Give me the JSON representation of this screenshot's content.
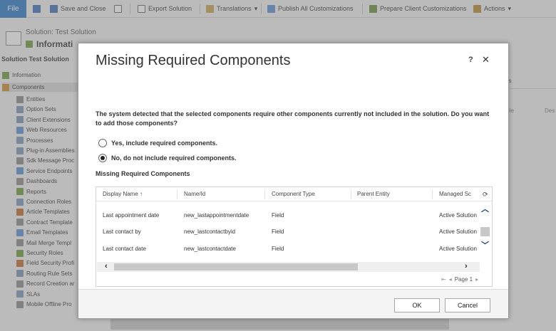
{
  "toolbar": {
    "file": "File",
    "save_and_close": "Save and Close",
    "export_solution": "Export Solution",
    "translations": "Translations",
    "publish_all": "Publish All Customizations",
    "prepare_client": "Prepare Client Customizations",
    "actions": "Actions"
  },
  "background": {
    "solution_title": "Solution: Test Solution",
    "info_title": "Informati",
    "sidebar_heading": "Solution Test Solution",
    "right_tab_partial": "nents",
    "right_col1_partial": "izable",
    "right_col2_partial": "Des",
    "sidebar": [
      {
        "label": "Information",
        "icon": "information-icon"
      },
      {
        "label": "Components",
        "icon": "components-icon"
      },
      {
        "label": "Entities",
        "icon": "entities-icon"
      },
      {
        "label": "Option Sets",
        "icon": "option-sets-icon"
      },
      {
        "label": "Client Extensions",
        "icon": "client-extensions-icon"
      },
      {
        "label": "Web Resources",
        "icon": "web-resources-icon"
      },
      {
        "label": "Processes",
        "icon": "processes-icon"
      },
      {
        "label": "Plug-in Assemblies",
        "icon": "plugin-icon"
      },
      {
        "label": "Sdk Message Proc",
        "icon": "sdk-icon"
      },
      {
        "label": "Service Endpoints",
        "icon": "endpoint-icon"
      },
      {
        "label": "Dashboards",
        "icon": "dashboard-icon"
      },
      {
        "label": "Reports",
        "icon": "reports-icon"
      },
      {
        "label": "Connection Roles",
        "icon": "connection-icon"
      },
      {
        "label": "Article Templates",
        "icon": "article-icon"
      },
      {
        "label": "Contract Template",
        "icon": "contract-icon"
      },
      {
        "label": "Email Templates",
        "icon": "email-icon"
      },
      {
        "label": "Mail Merge Templ",
        "icon": "mail-merge-icon"
      },
      {
        "label": "Security Roles",
        "icon": "security-icon"
      },
      {
        "label": "Field Security Profi",
        "icon": "field-security-icon"
      },
      {
        "label": "Routing Rule Sets",
        "icon": "routing-icon"
      },
      {
        "label": "Record Creation ar",
        "icon": "record-creation-icon"
      },
      {
        "label": "SLAs",
        "icon": "sla-icon"
      },
      {
        "label": "Mobile Offline Pro",
        "icon": "mobile-icon"
      }
    ]
  },
  "dialog": {
    "title": "Missing Required Components",
    "help": "?",
    "close": "✕",
    "question": "The system detected that the selected components require other components currently not included in the solution. Do you want to add those components?",
    "option_yes": "Yes, include required components.",
    "option_no": "No, do not include required components.",
    "selected_option": "no",
    "section_label": "Missing Required Components",
    "grid": {
      "columns": [
        "Display Name ↑",
        "Name/Id",
        "Component Type",
        "Parent Entity",
        "Managed Sc"
      ],
      "rows": [
        {
          "display": "Last appointment date",
          "name": "new_lastappointmentdate",
          "type": "Field",
          "parent": "",
          "managed": "Active Solution"
        },
        {
          "display": "Last contact by",
          "name": "new_lastcontactbyid",
          "type": "Field",
          "parent": "",
          "managed": "Active Solution"
        },
        {
          "display": "Last contact date",
          "name": "new_lastcontactdate",
          "type": "Field",
          "parent": "",
          "managed": "Active Solution"
        }
      ],
      "page_label": "Page 1"
    },
    "ok": "OK",
    "cancel": "Cancel"
  },
  "colors": {
    "file_button": "#2b79c9",
    "scroll_arrow": "#1f3d7a"
  }
}
